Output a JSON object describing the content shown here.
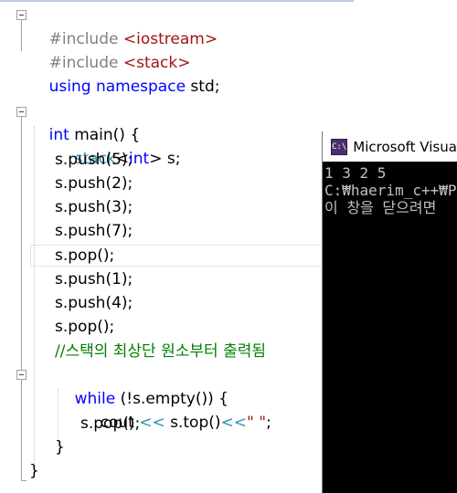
{
  "code": {
    "l1": {
      "pre": "#include ",
      "lib": "<iostream>"
    },
    "l2": {
      "pre": "#include ",
      "lib": "<stack>"
    },
    "l3": {
      "kw": "using namespace",
      "rest": " std;"
    },
    "l5": {
      "kw": "int",
      "rest": " main() {"
    },
    "l6": {
      "type": "stack",
      "lt": "<",
      "kw": "int",
      "rest": "> s;"
    },
    "l7": "s.push(5);",
    "l8": "s.push(2);",
    "l9": "s.push(3);",
    "l10": "s.push(7);",
    "l11": "s.pop();",
    "l12": "s.push(1);",
    "l13": "s.push(4);",
    "l14": "s.pop();",
    "l15": "//스택의 최상단 원소부터 출력됨",
    "l16": {
      "kw": "while",
      "rest": " (!s.empty()) {"
    },
    "l17": {
      "a": "cout ",
      "op1": "<<",
      "b": " s.top()",
      "op2": "<<",
      "str": "\" \"",
      "end": ";"
    },
    "l18": "s.pop();",
    "l19": "}",
    "l20": "}"
  },
  "console": {
    "title": "Microsoft Visual",
    "icon": "C:\\",
    "lines": [
      "1 3 2 5",
      "C:₩haerim_c++₩P",
      "이 창을 닫으려면"
    ]
  }
}
